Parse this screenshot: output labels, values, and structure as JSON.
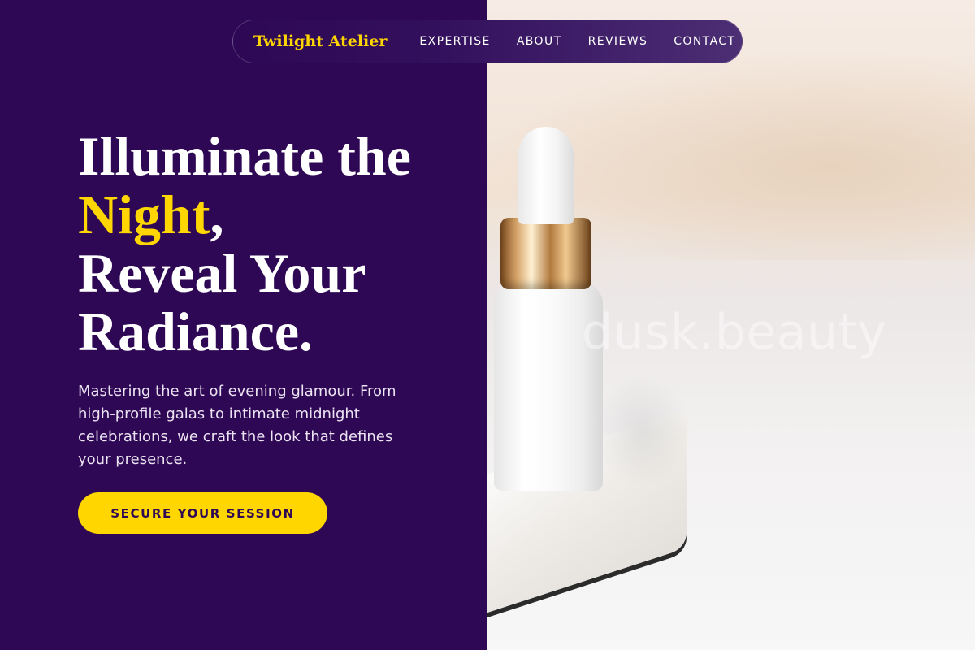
{
  "brand": "Twilight Atelier",
  "nav": [
    {
      "label": "EXPERTISE"
    },
    {
      "label": "ABOUT"
    },
    {
      "label": "REVIEWS"
    },
    {
      "label": "CONTACT"
    }
  ],
  "hero": {
    "headline_line1": "Illuminate the",
    "headline_accent": "Night",
    "headline_comma": ",",
    "headline_line3": "Reveal Your",
    "headline_line4": "Radiance.",
    "description": "Mastering the art of evening glamour. From high-profile galas to intimate midnight celebrations, we craft the look that defines your presence.",
    "cta_label": "SECURE YOUR SESSION"
  },
  "image": {
    "watermark": "dusk.beauty"
  },
  "colors": {
    "primary_bg": "#2e0854",
    "accent": "#ffd600",
    "text": "#ffffff"
  }
}
